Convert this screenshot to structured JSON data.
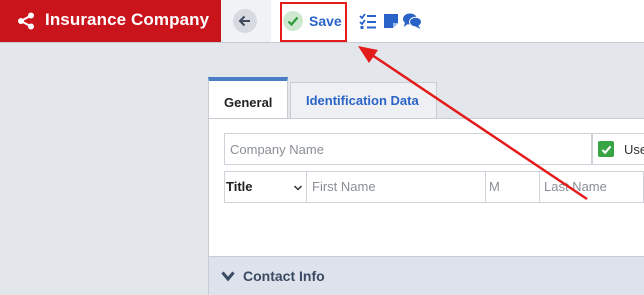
{
  "app": {
    "title": "Insurance Company",
    "brand_color": "#c9141c"
  },
  "toolbar": {
    "back_icon": "arrow-left-icon",
    "save_label": "Save",
    "save_icon": "check-icon",
    "icons": [
      "checklist-icon",
      "note-icon",
      "comments-icon"
    ],
    "accent_color": "#2a63c7"
  },
  "tabs": [
    {
      "label": "General",
      "active": true
    },
    {
      "label": "Identification Data",
      "active": false
    }
  ],
  "form": {
    "company_name_placeholder": "Company Name",
    "use_checkbox_label": "Use",
    "title_select_value": "Title",
    "first_name_placeholder": "First Name",
    "middle_placeholder": "M",
    "last_name_placeholder": "Last Name"
  },
  "sections": {
    "contact_info": "Contact Info"
  },
  "annotation": {
    "highlight_color": "#e31b1b"
  }
}
